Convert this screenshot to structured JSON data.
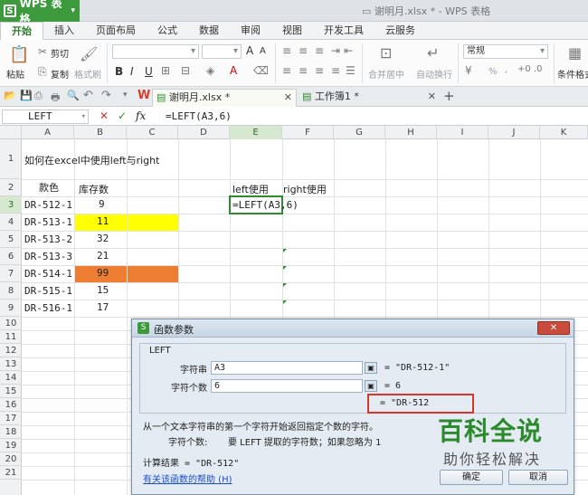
{
  "app": {
    "name": "WPS 表格",
    "window_title": "谢明月.xlsx * - WPS 表格"
  },
  "menu_tabs": [
    "开始",
    "插入",
    "页面布局",
    "公式",
    "数据",
    "审阅",
    "视图",
    "开发工具",
    "云服务"
  ],
  "ribbon": {
    "paste": "粘贴",
    "cut": "剪切",
    "copy": "复制",
    "format_painter": "格式刷",
    "bold": "B",
    "italic": "I",
    "underline": "U",
    "font_grow": "A",
    "font_shrink": "A",
    "merge_center": "合并居中",
    "wrap_text": "自动换行",
    "number_format": "常规",
    "percent": "%",
    "comma": ",",
    "conditional_format": "条件格式"
  },
  "doc_tabs": [
    {
      "label": "谢明月.xlsx *",
      "active": true
    },
    {
      "label": "工作簿1 *",
      "active": false
    }
  ],
  "formula_bar": {
    "name_box": "LEFT",
    "fx": "fx",
    "formula": "=LEFT(A3,6)"
  },
  "columns": [
    "A",
    "B",
    "C",
    "D",
    "E",
    "F",
    "G",
    "H",
    "I",
    "J",
    "K"
  ],
  "rows": [
    "1",
    "2",
    "3",
    "4",
    "5",
    "6",
    "7",
    "8",
    "9",
    "10",
    "11",
    "12",
    "13",
    "14",
    "15",
    "16",
    "17",
    "18",
    "19",
    "20",
    "21"
  ],
  "cells": {
    "A1": "如何在excel中使用left与right",
    "A2": "款色",
    "B2": "库存数",
    "E2": "left使用",
    "F2": "right使用",
    "A3": "DR-512-1",
    "B3": "9",
    "A4": "DR-513-1",
    "B4": "11",
    "A5": "DR-513-2",
    "B5": "32",
    "A6": "DR-513-3",
    "B6": "21",
    "A7": "DR-514-1",
    "B7": "99",
    "A8": "DR-515-1",
    "B8": "15",
    "A9": "DR-516-1",
    "B9": "17",
    "E3": "=LEFT(A3,6)"
  },
  "colors": {
    "yellow_fill": "#ffff00",
    "orange_fill": "#ed7d31",
    "accent": "#3c9a3c"
  },
  "dialog": {
    "title": "函数参数",
    "function_name": "LEFT",
    "arg1_label": "字符串",
    "arg1_value": "A3",
    "arg1_result": "= \"DR-512-1\"",
    "arg2_label": "字符个数",
    "arg2_value": "6",
    "arg2_result": "= 6",
    "result_preview": "= \"DR-512",
    "description": "从一个文本字符串的第一个字符开始返回指定个数的字符。",
    "arg_help_label": "字符个数:",
    "arg_help_text": "要 LEFT 提取的字符数；如果忽略为 1",
    "calc_result": "计算结果 = \"DR-512\"",
    "help_link": "有关该函数的帮助 (H)",
    "ok": "确定",
    "cancel": "取消"
  },
  "watermark": {
    "line1": "百科全说",
    "line2": "助你轻松解决"
  }
}
